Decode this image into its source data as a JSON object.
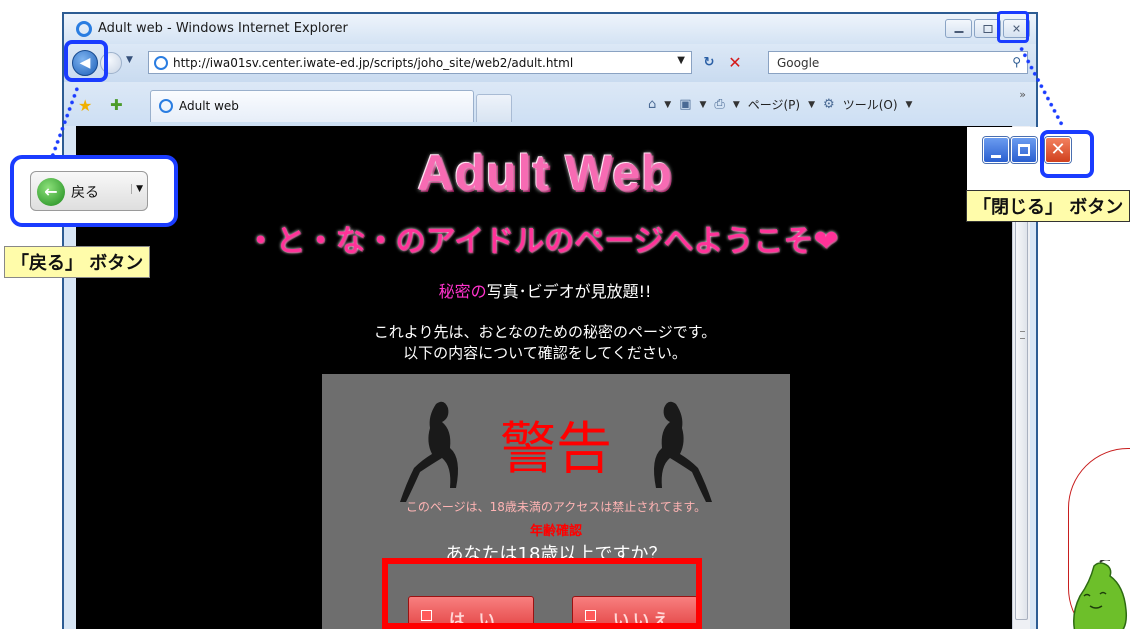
{
  "browser": {
    "window_title": "Adult web - Windows Internet Explorer",
    "address": "http://iwa01sv.center.iwate-ed.jp/scripts/joho_site/web2/adult.html",
    "search_placeholder": "Google",
    "tab_label": "Adult web",
    "page_menu": "ページ(P)",
    "tools_menu": "ツール(O)"
  },
  "page": {
    "title": "Adult Web",
    "subtitle": "・と・な・のアイドルのページへようこそ❤",
    "secret_accent": "秘密の",
    "secret_rest": "写真･ビデオが見放題!!",
    "intro_line1": "これより先は、おとなのための秘密のページです。",
    "intro_line2": "以下の内容について確認をしてください。",
    "warning": {
      "title": "警告",
      "note": "このページは、18歳未満のアクセスは禁止されてます。",
      "age_check": "年齢確認",
      "question": "あなたは18歳以上ですか？",
      "yes_label": "は い",
      "no_label": "いいえ"
    }
  },
  "annotations": {
    "back_button_label": "戻る",
    "back_caption": "「戻る」 ボタン",
    "close_caption": "「閉じる」 ボタン"
  },
  "colors": {
    "highlight": "#1a3cff",
    "alert_frame": "#ff0000",
    "title_pink": "#f76bb3",
    "caption_bg": "#fffcaa"
  }
}
